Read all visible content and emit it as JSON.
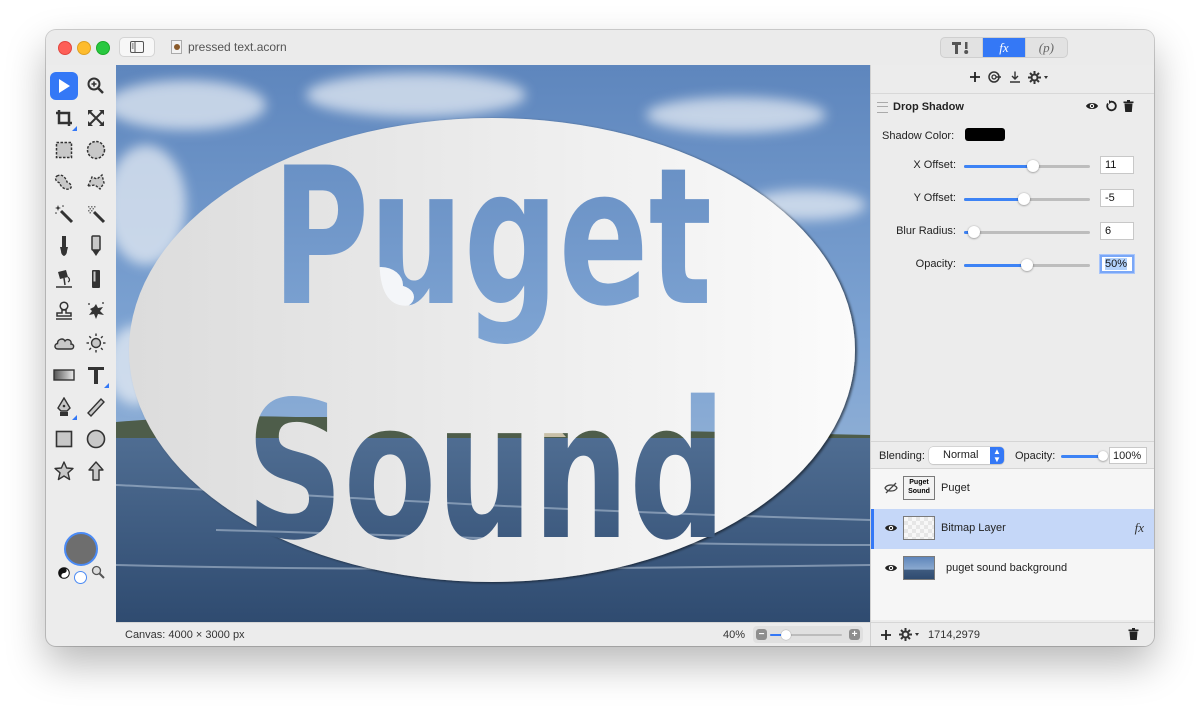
{
  "window": {
    "document_title": "pressed text.acorn"
  },
  "inspector_tabs": [
    {
      "name": "tools",
      "label": "T!",
      "icon": "hammer-brush-icon"
    },
    {
      "name": "effects",
      "label": "fx",
      "active": true
    },
    {
      "name": "properties",
      "label": "(p)"
    }
  ],
  "effects_toolbar": {
    "add_icon": "plus-icon",
    "effects_icon": "swirl-icon",
    "merge_icon": "download-icon",
    "settings_icon": "gear-menu-icon"
  },
  "effect": {
    "title": "Drop Shadow",
    "shadow_color_label": "Shadow Color:",
    "shadow_color": "#000000",
    "params": [
      {
        "label": "X Offset:",
        "value": "11",
        "slider_fraction": 0.55
      },
      {
        "label": "Y Offset:",
        "value": "-5",
        "slider_fraction": 0.48
      },
      {
        "label": "Blur Radius:",
        "value": "6",
        "slider_fraction": 0.08
      },
      {
        "label": "Opacity:",
        "value": "50%",
        "slider_fraction": 0.5,
        "focused": true
      }
    ]
  },
  "blend": {
    "label": "Blending:",
    "mode": "Normal",
    "opacity_label": "Opacity:",
    "opacity": "100%",
    "opacity_fraction": 1.0
  },
  "layers": [
    {
      "name": "Puget",
      "visible": false,
      "selected": false,
      "has_fx": false,
      "thumb": "text",
      "thumb_text": [
        "Puget",
        "Sound"
      ]
    },
    {
      "name": "Bitmap Layer",
      "visible": true,
      "selected": true,
      "has_fx": true,
      "fx_label": "fx",
      "thumb": "checker"
    },
    {
      "name": "puget sound background",
      "visible": true,
      "selected": false,
      "has_fx": false,
      "thumb": "photo"
    }
  ],
  "layers_footer": {
    "coords": "1714,2979"
  },
  "status": {
    "canvas_size": "Canvas: 4000 × 3000 px",
    "zoom": "40%",
    "zoom_fraction": 0.22
  },
  "canvas": {
    "line1": "Puget",
    "line2": "Sound"
  },
  "tools": [
    "pointer-icon",
    "zoom-icon",
    "crop-icon",
    "transform-icon",
    "rect-select-icon",
    "ellipse-select-icon",
    "lasso-icon",
    "polygon-lasso-icon",
    "magic-wand-icon",
    "magic-wand-soft-icon",
    "brush-icon",
    "pencil-icon",
    "paint-bucket-icon",
    "eraser-icon",
    "clone-stamp-icon",
    "splatter-icon",
    "cloud-icon",
    "sun-icon",
    "gradient-icon",
    "text-icon",
    "pen-icon",
    "line-icon",
    "rectangle-icon",
    "circle-icon",
    "star-icon",
    "arrow-icon"
  ],
  "colors": {
    "accent": "#3478f6",
    "selected_layer": "#c5d7f8",
    "foreground_color": "#6e6e6e"
  }
}
